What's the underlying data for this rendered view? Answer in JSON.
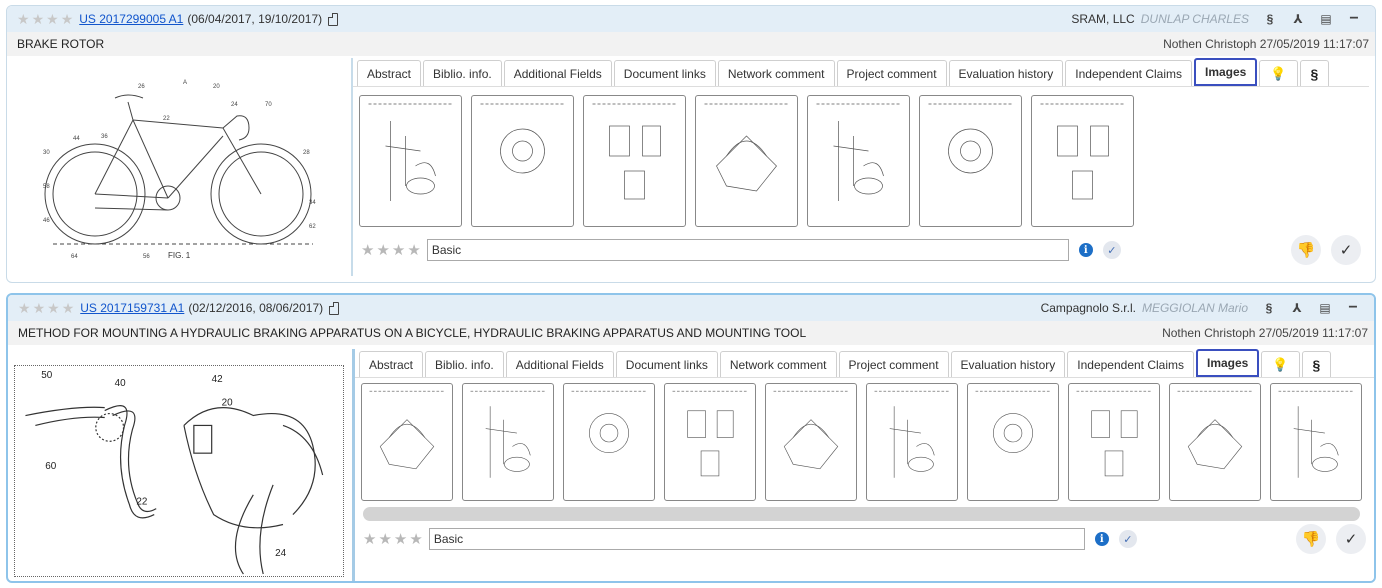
{
  "records": [
    {
      "pub_number": "US 2017299005 A1",
      "dates": "(06/04/2017, 19/10/2017)",
      "company": "SRAM, LLC",
      "agent": "DUNLAP CHARLES",
      "title": "BRAKE ROTOR",
      "owner_stamp": "Nothen Christoph 27/05/2019 11:17:07",
      "thumb_labels": [
        "FIG. 1"
      ],
      "tabs": [
        "Abstract",
        "Biblio. info.",
        "Additional Fields",
        "Document links",
        "Network comment",
        "Project comment",
        "Evaluation history",
        "Independent Claims",
        "Images"
      ],
      "active_tab": "Images",
      "image_count": 7,
      "eval_value": "Basic"
    },
    {
      "pub_number": "US 2017159731 A1",
      "dates": "(02/12/2016, 08/06/2017)",
      "company": "Campagnolo S.r.l.",
      "agent": "MEGGIOLAN Mario",
      "title": "METHOD FOR MOUNTING A HYDRAULIC BRAKING APPARATUS ON A BICYCLE, HYDRAULIC BRAKING APPARATUS AND MOUNTING TOOL",
      "owner_stamp": "Nothen Christoph 27/05/2019 11:17:07",
      "thumb_labels": [
        "50",
        "40",
        "42",
        "20",
        "60",
        "22",
        "24"
      ],
      "tabs": [
        "Abstract",
        "Biblio. info.",
        "Additional Fields",
        "Document links",
        "Network comment",
        "Project comment",
        "Evaluation history",
        "Independent Claims",
        "Images"
      ],
      "active_tab": "Images",
      "image_count": 10,
      "eval_value": "Basic"
    }
  ],
  "icons": {
    "star": "star-icon",
    "document": "document-icon",
    "section": "section-icon",
    "pdf": "pdf-icon",
    "report": "report-icon",
    "minimize": "minimize-icon",
    "bulb": "lightbulb-icon",
    "info": "info-icon",
    "check": "check-icon",
    "thumbs_down": "thumbs-down-icon"
  },
  "colors": {
    "header_bg": "#e3eef7",
    "link": "#1155cc",
    "active_tab_border": "#3a4fbf",
    "info_blue": "#1d6fc7"
  }
}
